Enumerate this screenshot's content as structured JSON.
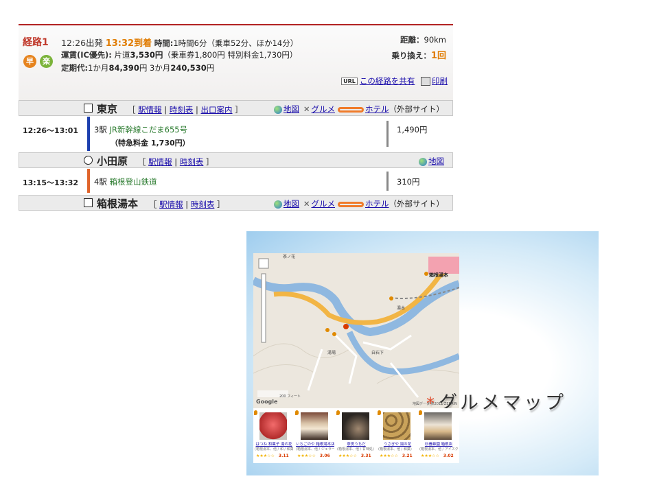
{
  "route": {
    "name": "経路1",
    "depart": "12:26出発",
    "arrive": "13:32到着",
    "time_label": "時間:",
    "time_value": "1時間6分（乗車52分、ほか14分）",
    "fare_label": "運賃(IC優先):",
    "fare_value_prefix": "片道",
    "fare_value": "3,530円",
    "fare_detail": "（乗車券1,800円 特別料金1,730円）",
    "commuter_label": "定期代:",
    "commuter_1m_label": "1か月",
    "commuter_1m": "84,390",
    "commuter_1m_unit": "円",
    "commuter_3m_label": "3か月",
    "commuter_3m": "240,530",
    "commuter_3m_unit": "円",
    "badges": [
      "早",
      "楽"
    ],
    "distance_label": "距離：",
    "distance_value": "90km",
    "transfer_label": "乗り換え：",
    "transfer_count": "1",
    "transfer_unit": "回",
    "url_badge": "URL",
    "share_link": "この経路を共有",
    "print_link": "印刷"
  },
  "stations": [
    {
      "name": "東京",
      "symbol": "square",
      "links": [
        "駅情報",
        "時刻表",
        "出口案内"
      ],
      "map": "地図",
      "gourmet": "グルメ",
      "hotel": "ホテル",
      "external": "（外部サイト）"
    },
    {
      "name": "小田原",
      "symbol": "circle",
      "links": [
        "駅情報",
        "時刻表"
      ],
      "map": "地図"
    },
    {
      "name": "箱根湯本",
      "symbol": "square",
      "links": [
        "駅情報",
        "時刻表"
      ],
      "map": "地図",
      "gourmet": "グルメ",
      "hotel": "ホテル",
      "external": "（外部サイト）"
    }
  ],
  "segments": [
    {
      "time": "12:26〜13:01",
      "stops": "3駅",
      "train": "JR新幹線こだま655号",
      "note": "（特急料金 1,730円）",
      "fare": "1,490円",
      "color": "#1d3fae"
    },
    {
      "time": "13:15〜13:32",
      "stops": "4駅",
      "train": "箱根登山鉄道",
      "fare": "310円",
      "color": "#e0642b"
    }
  ],
  "slide": {
    "title_mark": "*",
    "title": "グルメマップ",
    "map_labels": {
      "station": "箱根湯本",
      "top": "茶ノ花",
      "yumoto": "湯本",
      "shiraishi": "白石下",
      "yuba": "湯場",
      "google": "Google",
      "scale": "200 フィート",
      "copyright": "地図データ ©2011 ZENRIN"
    },
    "shops": [
      {
        "name": "はつね 和菓子 湯の花",
        "info": "(箱根湯本、他 / 和 / 和菓)",
        "stars": "★★★☆☆",
        "score": "3.11"
      },
      {
        "name": "いちごのや 箱根湯本店",
        "info": "(箱根湯本、他 / ジェラート)",
        "stars": "★★★☆☆",
        "score": "3.06"
      },
      {
        "name": "茶房うちだ",
        "info": "(箱根湯本、他 / 甘味処)",
        "stars": "★★★☆☆",
        "score": "3.31"
      },
      {
        "name": "うさぎや 湯の花",
        "info": "(箱根湯本、他 / 和菓)",
        "stars": "★★★☆☆",
        "score": "3.21"
      },
      {
        "name": "杉養蜂園 箱根店",
        "info": "(箱根湯本、他 / アイスクリーム)",
        "stars": "★★★☆☆",
        "score": "3.02"
      }
    ]
  }
}
